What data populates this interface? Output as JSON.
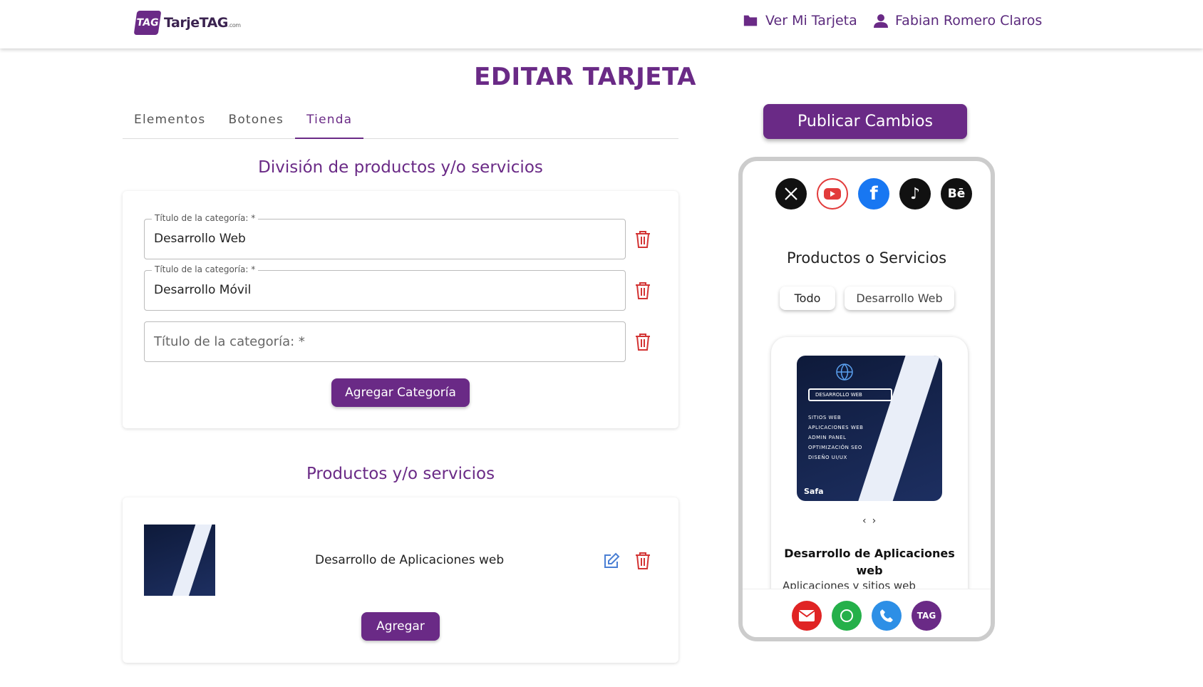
{
  "header": {
    "logo_mark": "TAG",
    "logo_text": "TarjeTAG",
    "logo_suffix": ".com",
    "nav_card": "Ver Mi Tarjeta",
    "nav_user": "Fabian Romero Claros"
  },
  "page_title": "EDITAR TARJETA",
  "tabs": [
    {
      "label": "Elementos"
    },
    {
      "label": "Botones"
    },
    {
      "label": "Tienda",
      "active": true
    }
  ],
  "division": {
    "title": "División de productos y/o servicios",
    "fields": [
      {
        "label": "Título de la categoría: *",
        "value": "Desarrollo Web"
      },
      {
        "label": "Título de la categoría: *",
        "value": "Desarrollo Móvil"
      },
      {
        "placeholder": "Título de la categoría: *",
        "value": ""
      }
    ],
    "add_button": "Agregar Categoría"
  },
  "products": {
    "title": "Productos y/o servicios",
    "items": [
      {
        "name": "Desarrollo de Aplicaciones web"
      }
    ],
    "add_button": "Agregar"
  },
  "publish_button": "Publicar Cambios",
  "preview": {
    "social_icons": [
      "x-icon",
      "youtube-icon",
      "facebook-icon",
      "tiktok-icon",
      "behance-icon"
    ],
    "section_title": "Productos o Servicios",
    "filters": [
      {
        "label": "Todo",
        "active": true
      },
      {
        "label": "Desarrollo Web"
      }
    ],
    "product_card": {
      "image_search_label": "DESARROLLO WEB",
      "image_list": [
        "SITIOS WEB",
        "APLICACIONES WEB",
        "ADMIN PANEL",
        "OPTIMIZACIÓN SEO",
        "DISEÑO UI/UX"
      ],
      "image_brand": "Safa",
      "title": "Desarrollo de Aplicaciones web",
      "description": "Aplicaciones y sitios web"
    },
    "dock_icons": [
      "email-icon",
      "whatsapp-icon",
      "phone-icon",
      "tag-logo-icon"
    ]
  },
  "colors": {
    "brand": "#6a2a86",
    "danger": "#d33434",
    "edit": "#4a7fd4"
  }
}
